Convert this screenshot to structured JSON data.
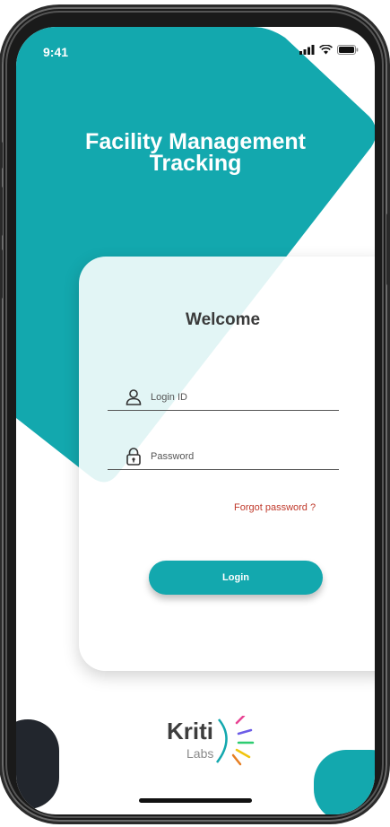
{
  "status_bar": {
    "time": "9:41",
    "icons": [
      "signal-icon",
      "wifi-icon",
      "battery-icon"
    ]
  },
  "app": {
    "title_line1": "Facility Management",
    "title_line2": "Tracking"
  },
  "login_card": {
    "welcome": "Welcome",
    "login_id_placeholder": "Login ID",
    "password_placeholder": "Password",
    "forgot_password": "Forgot password ?",
    "login_button": "Login"
  },
  "brand": {
    "name": "Kriti",
    "sub": "Labs"
  },
  "colors": {
    "accent": "#13a8ae",
    "forgot_link": "#c0392b",
    "text_dark": "#3a3a3a"
  }
}
